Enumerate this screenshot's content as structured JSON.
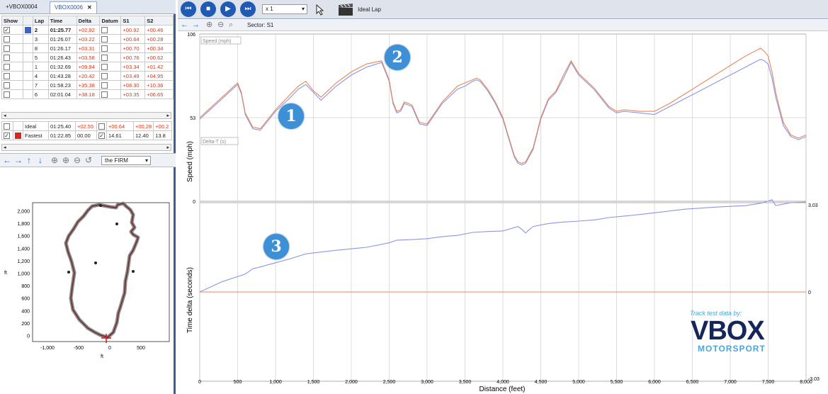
{
  "tabs": [
    {
      "label": "+VBOX0004",
      "active": false
    },
    {
      "label": "VBOX0006",
      "active": true,
      "close": "✕"
    }
  ],
  "lap_table": {
    "headers": [
      "Show",
      "",
      "Lap",
      "Time",
      "Delta",
      "Datum",
      "S1",
      "S2"
    ],
    "rows": [
      {
        "checked": true,
        "color": "#3e63c8",
        "lap": "2",
        "time": "01:25.77",
        "delta": "+02.92",
        "s1": "+00.92",
        "s2": "+00.46",
        "bold": true
      },
      {
        "checked": false,
        "color": "",
        "lap": "3",
        "time": "01:26.07",
        "delta": "+03.22",
        "s1": "+00.64",
        "s2": "+00.28",
        "bold": false
      },
      {
        "checked": false,
        "color": "",
        "lap": "8",
        "time": "01:26.17",
        "delta": "+03.31",
        "s1": "+00.70",
        "s2": "+00.34",
        "bold": false
      },
      {
        "checked": false,
        "color": "",
        "lap": "5",
        "time": "01:26.43",
        "delta": "+03.58",
        "s1": "+00.76",
        "s2": "+00.62",
        "bold": false
      },
      {
        "checked": false,
        "color": "",
        "lap": "1",
        "time": "01:32.69",
        "delta": "+09.84",
        "s1": "+03.34",
        "s2": "+01.42",
        "bold": false
      },
      {
        "checked": false,
        "color": "",
        "lap": "4",
        "time": "01:43.28",
        "delta": "+20.42",
        "s1": "+03.49",
        "s2": "+04.95",
        "bold": false
      },
      {
        "checked": false,
        "color": "",
        "lap": "7",
        "time": "01:58.23",
        "delta": "+35.38",
        "s1": "+08.30",
        "s2": "+10.36",
        "bold": false
      },
      {
        "checked": false,
        "color": "",
        "lap": "6",
        "time": "02:01.04",
        "delta": "+38.18",
        "s1": "+03.35",
        "s2": "+06.65",
        "bold": false
      }
    ]
  },
  "summary_rows": [
    {
      "checked": false,
      "color": "",
      "name": "Ideal",
      "time": "01:25.40",
      "delta": "+02.55",
      "datum": false,
      "s1": "+00.64",
      "s2": "+00.28",
      "s3": "+00.2"
    },
    {
      "checked": true,
      "color": "#d42a1e",
      "name": "Fastest",
      "time": "01:22.85",
      "delta": "00.00",
      "datum": true,
      "s1": "14.61",
      "s2": "12.40",
      "s3": "13.8"
    }
  ],
  "scroll_arrows": {
    "left": "◂",
    "right": "▸"
  },
  "map_toolbar": {
    "icons": [
      "←",
      "→",
      "↑",
      "↓",
      "⊕",
      "⊕",
      "⊖",
      "↺"
    ],
    "dropdown": "the FIRM",
    "dropdown_arrow": "▾"
  },
  "track_map": {
    "y_ticks": [
      "2,000",
      "1,800",
      "1,600",
      "1,400",
      "1,200",
      "1,000",
      "800",
      "600",
      "400",
      "200",
      "0"
    ],
    "x_ticks": [
      "-1,000",
      "-500",
      "0",
      "500"
    ],
    "y_label": "ft",
    "x_label": "ft"
  },
  "top_toolbar": {
    "buttons": [
      "⏮",
      "■",
      "▶",
      "⏭"
    ],
    "speed_value": "x 1",
    "mode_label": "Ideal Lap"
  },
  "sub_toolbar": {
    "icons": [
      "←",
      "→",
      "⊕",
      "⊖",
      "⌕"
    ],
    "sector_label": "Sector: S1"
  },
  "chart_data": [
    {
      "type": "line",
      "title": "",
      "xlabel": "Distance (feet)",
      "ylabel": "Speed (mph)",
      "legend_label": "Speed (mph)",
      "ylim": [
        0,
        106
      ],
      "y_ticks": [
        "106",
        "53",
        "0"
      ],
      "x": [
        0,
        500,
        550,
        600,
        700,
        800,
        1000,
        1200,
        1300,
        1400,
        1500,
        1600,
        1800,
        2000,
        2200,
        2400,
        2500,
        2550,
        2600,
        2650,
        2700,
        2800,
        2900,
        3000,
        3200,
        3400,
        3500,
        3600,
        3650,
        3700,
        3800,
        3900,
        4000,
        4100,
        4150,
        4200,
        4250,
        4300,
        4400,
        4500,
        4600,
        4700,
        4800,
        4900,
        5000,
        5200,
        5400,
        5500,
        5600,
        5800,
        6000,
        6200,
        6400,
        6600,
        6800,
        7000,
        7200,
        7400,
        7450,
        7500,
        7550,
        7600,
        7650,
        7700,
        7800,
        7900,
        8000
      ],
      "series": [
        {
          "color": "#8c95e8",
          "values": [
            52,
            74,
            68,
            55,
            46,
            45,
            57,
            66,
            71,
            74,
            69,
            64,
            73,
            80,
            85,
            88,
            76,
            62,
            56,
            57,
            62,
            60,
            49,
            48,
            62,
            71,
            73,
            76,
            77,
            76,
            70,
            62,
            52,
            36,
            28,
            24,
            23,
            24,
            33,
            52,
            64,
            69,
            78,
            88,
            80,
            71,
            59,
            56,
            57,
            56,
            55,
            60,
            65,
            70,
            75,
            80,
            85,
            90,
            89,
            87,
            78,
            66,
            57,
            48,
            41,
            39,
            41
          ]
        },
        {
          "color": "#e8865a",
          "values": [
            53,
            75,
            69,
            56,
            47,
            46,
            58,
            68,
            73,
            76,
            70,
            66,
            75,
            82,
            87,
            89,
            77,
            63,
            57,
            58,
            63,
            61,
            50,
            49,
            63,
            73,
            75,
            77,
            78,
            77,
            71,
            63,
            53,
            37,
            29,
            25,
            24,
            25,
            34,
            53,
            65,
            70,
            80,
            89,
            81,
            72,
            60,
            57,
            58,
            57,
            57,
            62,
            68,
            74,
            80,
            86,
            92,
            97,
            95,
            92,
            82,
            69,
            59,
            50,
            42,
            40,
            42
          ]
        }
      ]
    },
    {
      "type": "line",
      "title": "",
      "xlabel": "Distance (feet)",
      "ylabel": "Time delta (seconds)",
      "legend_label": "Delta-T (s)",
      "ylim": [
        -3,
        3
      ],
      "y_ticks": [
        "3.03",
        "0",
        "-3.03"
      ],
      "x_ticks": [
        "0",
        "500",
        "1,000",
        "1,500",
        "2,000",
        "2,500",
        "3,000",
        "3,500",
        "4,000",
        "4,500",
        "5,000",
        "5,500",
        "6,000",
        "6,500",
        "7,000",
        "7,500",
        "8,000"
      ],
      "x": [
        0,
        300,
        600,
        700,
        800,
        1000,
        1200,
        1400,
        1800,
        2200,
        2500,
        2600,
        2800,
        3000,
        3200,
        3400,
        3600,
        3800,
        4000,
        4200,
        4250,
        4300,
        4350,
        4400,
        4600,
        4800,
        5000,
        5200,
        5400,
        5600,
        5800,
        6000,
        6400,
        6800,
        7200,
        7400,
        7500,
        7550,
        7600,
        7700,
        7800,
        8000
      ],
      "series": [
        {
          "color": "#8c95e8",
          "values": [
            0.0,
            0.35,
            0.6,
            0.78,
            0.84,
            0.98,
            1.12,
            1.28,
            1.4,
            1.5,
            1.65,
            1.74,
            1.76,
            1.79,
            1.86,
            1.9,
            2.0,
            2.03,
            2.05,
            2.2,
            2.1,
            1.98,
            2.1,
            2.2,
            2.3,
            2.35,
            2.38,
            2.42,
            2.5,
            2.55,
            2.6,
            2.66,
            2.78,
            2.85,
            2.9,
            2.98,
            3.05,
            3.1,
            2.9,
            2.95,
            3.0,
            3.02
          ]
        },
        {
          "color": "#e8865a",
          "values": [
            0,
            0,
            0,
            0,
            0,
            0,
            0,
            0,
            0,
            0,
            0,
            0,
            0,
            0,
            0,
            0,
            0,
            0,
            0,
            0,
            0,
            0,
            0,
            0,
            0,
            0,
            0,
            0,
            0,
            0,
            0,
            0,
            0,
            0,
            0,
            0,
            0,
            0,
            0,
            0,
            0,
            0
          ]
        }
      ]
    }
  ],
  "badges": [
    "1",
    "2",
    "3"
  ],
  "branding": {
    "track_test": "Track test data by:",
    "vbox": "VBOX",
    "motorsport": "MOTORSPORT"
  }
}
